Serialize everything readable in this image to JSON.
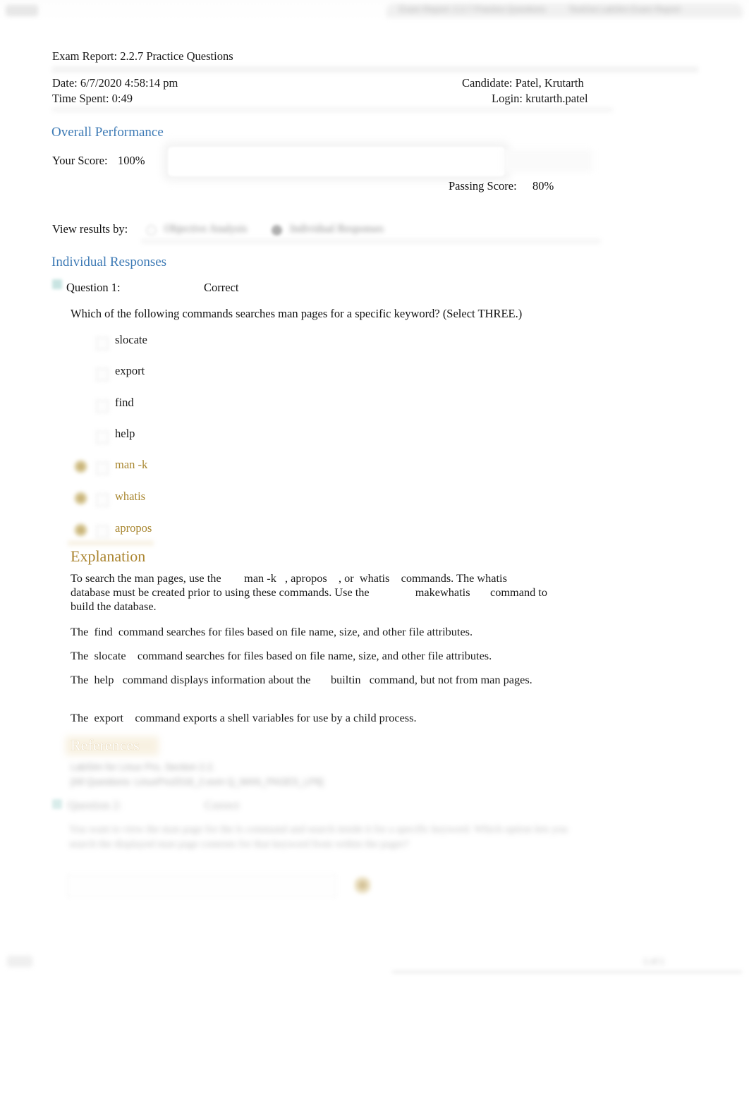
{
  "browser": {
    "left_chip": "",
    "tab_title": "Exam Report: 2.2.7 Practice Questions",
    "address_text": "TestOut LabSim Exam Report"
  },
  "report": {
    "title": "Exam Report: 2.2.7 Practice Questions",
    "date": "Date: 6/7/2020 4:58:14 pm",
    "time_spent": "Time Spent: 0:49",
    "candidate": "Candidate: Patel, Krutarth",
    "login": "Login: krutarth.patel"
  },
  "overall_performance": {
    "heading": "Overall Performance",
    "your_score_label": "Your Score:",
    "your_score_value": "100%",
    "passing_score_label": "Passing Score:",
    "passing_score_value": "80%",
    "view_results_label": "View results by:",
    "view_options": [
      {
        "label": "Objective Analysis",
        "selected": false
      },
      {
        "label": "Individual Responses",
        "selected": true
      }
    ]
  },
  "individual_responses": {
    "heading": "Individual Responses",
    "questions": [
      {
        "label": "Question 1:",
        "result": "Correct",
        "status_icon": "correct-check-icon",
        "text": "Which of the following commands searches man pages for a specific keyword? (Select THREE.)",
        "options": [
          {
            "text": "slocate",
            "correct": false
          },
          {
            "text": "export",
            "correct": false
          },
          {
            "text": "find",
            "correct": false
          },
          {
            "text": "help",
            "correct": false
          },
          {
            "text": "man -k",
            "correct": true
          },
          {
            "text": "whatis",
            "correct": true
          },
          {
            "text": "apropos",
            "correct": true
          }
        ],
        "explanation": {
          "heading": "Explanation",
          "paragraphs": [
            "To search the man pages, use the        man -k   , apropos    , or  whatis    commands. The whatis\ndatabase must be created prior to using these commands. Use the                makewhatis       command to\nbuild the database.",
            "The  find  command searches for files based on file name, size, and other file attributes.",
            "The  slocate    command searches for files based on file name, size, and other file attributes.",
            "The  help   command displays information about the       builtin   command, but not from man pages.",
            "The  export    command exports a shell variables for use by a child process."
          ]
        },
        "references": {
          "heading": "References",
          "lines": [
            "LabSim for Linux Pro, Section 2.2.",
            "[All Questions: LinuxPro2018_2.exm Q_MAN_PAGES_LP6]"
          ]
        }
      },
      {
        "label": "Question 2:",
        "result": "Correct",
        "status_icon": "correct-check-icon",
        "text": "You want to view the man page for the ls command and search inside it for a specific keyword. Which option lets you search the displayed man page contents for that keyword from within the pager?"
      }
    ]
  },
  "footer": {
    "page_chip": "",
    "right_text": "1 of 1"
  },
  "colors": {
    "section_heading_blue": "#3d7ab5",
    "correct_gold": "#a8862f",
    "explanation_gold": "#ab8530",
    "body_text": "#1a1a1a",
    "status_icon_teal": "#bfe0dd"
  }
}
